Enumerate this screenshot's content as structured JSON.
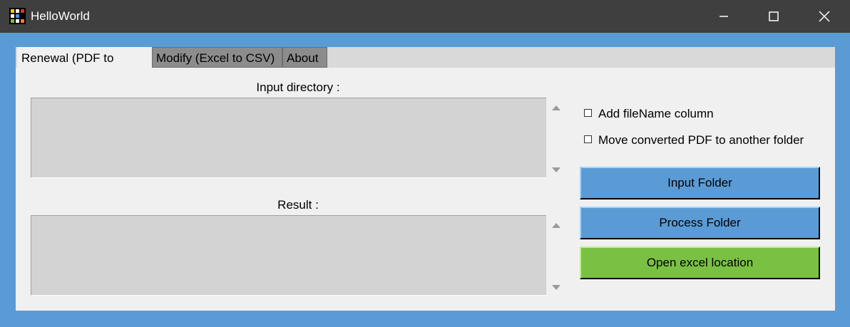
{
  "window": {
    "title": "HelloWorld",
    "minimize_icon": "minimize-icon",
    "maximize_icon": "maximize-icon",
    "close_icon": "close-icon"
  },
  "tabs": [
    {
      "label": "Renewal (PDF to Excel)",
      "active": true
    },
    {
      "label": "Modify (Excel to CSV)",
      "active": false
    },
    {
      "label": "About",
      "active": false
    }
  ],
  "main": {
    "input_directory_label": "Input directory :",
    "input_directory_value": "",
    "result_label": "Result :",
    "result_value": ""
  },
  "options": {
    "add_filename_label": "Add fileName column",
    "add_filename_checked": false,
    "move_pdf_label": "Move converted PDF to another folder",
    "move_pdf_checked": false
  },
  "buttons": {
    "input_folder": "Input Folder",
    "process_folder": "Process Folder",
    "open_excel": "Open excel location"
  },
  "colors": {
    "titlebar": "#3f3f3f",
    "frame": "#5b9bd5",
    "panel": "#f0f0f0",
    "button_blue": "#5b9bd5",
    "button_green": "#7ac143",
    "textbox": "#d3d3d3"
  }
}
